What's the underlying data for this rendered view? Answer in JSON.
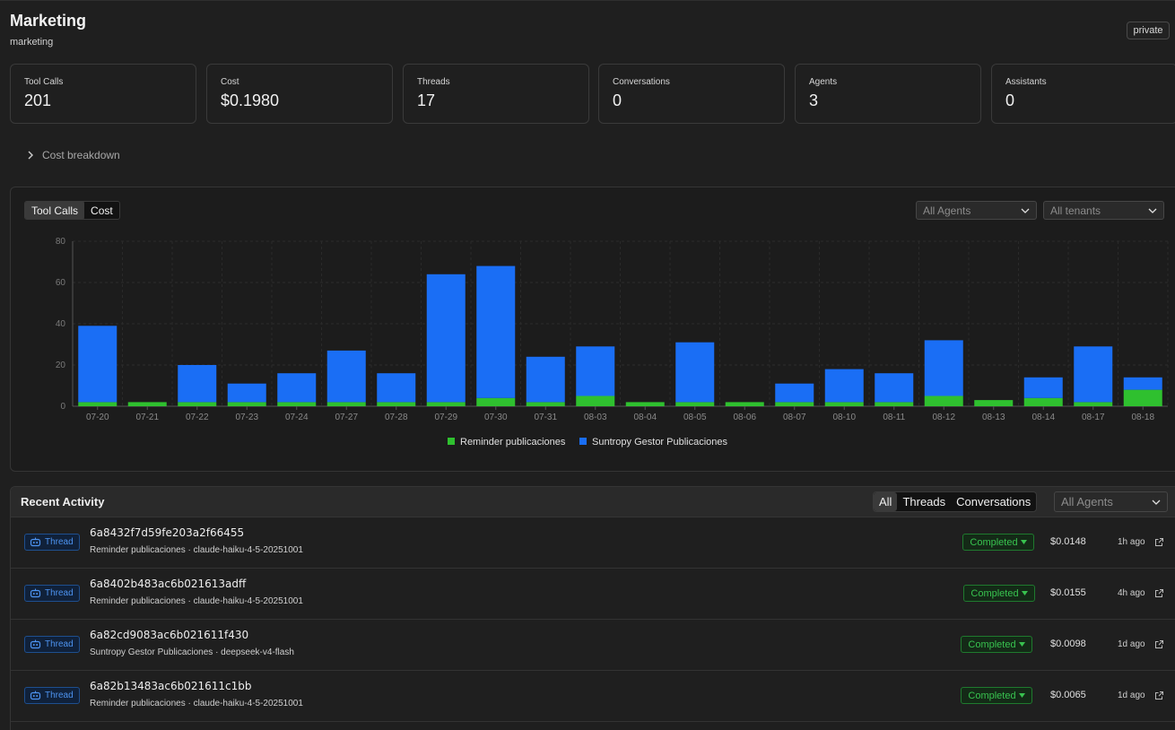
{
  "header": {
    "title": "Marketing",
    "subtitle": "marketing",
    "visibility_badge": "private"
  },
  "stats": [
    {
      "label": "Tool Calls",
      "value": "201"
    },
    {
      "label": "Cost",
      "value": "$0.1980"
    },
    {
      "label": "Threads",
      "value": "17"
    },
    {
      "label": "Conversations",
      "value": "0"
    },
    {
      "label": "Agents",
      "value": "3"
    },
    {
      "label": "Assistants",
      "value": "0"
    }
  ],
  "cost_breakdown": {
    "label": "Cost breakdown",
    "icon": "chevron-right-icon"
  },
  "chart_controls": {
    "metric_tabs": [
      "Tool Calls",
      "Cost"
    ],
    "active_tab": "Tool Calls",
    "agent_filter": "All Agents",
    "tenant_filter": "All tenants"
  },
  "chart_data": {
    "type": "bar",
    "stacked": true,
    "categories": [
      "07-20",
      "07-21",
      "07-22",
      "07-23",
      "07-24",
      "07-27",
      "07-28",
      "07-29",
      "07-30",
      "07-31",
      "08-03",
      "08-04",
      "08-05",
      "08-06",
      "08-07",
      "08-10",
      "08-11",
      "08-12",
      "08-13",
      "08-14",
      "08-17",
      "08-18"
    ],
    "series": [
      {
        "name": "Reminder publicaciones",
        "color": "#2fc02f",
        "values": [
          2,
          2,
          2,
          2,
          2,
          2,
          2,
          2,
          4,
          2,
          5,
          2,
          2,
          2,
          2,
          2,
          2,
          5,
          3,
          4,
          2,
          8
        ]
      },
      {
        "name": "Suntropy Gestor Publicaciones",
        "color": "#1a6ef5",
        "values": [
          37,
          0,
          18,
          9,
          14,
          25,
          14,
          62,
          64,
          22,
          24,
          0,
          29,
          0,
          9,
          16,
          14,
          27,
          0,
          10,
          27,
          6
        ]
      }
    ],
    "yticks": [
      "0",
      "20",
      "40",
      "60",
      "80"
    ],
    "ylim": [
      0,
      80
    ],
    "grid": true,
    "legend": "bottom-center"
  },
  "activity": {
    "title": "Recent Activity",
    "filters": [
      "All",
      "Threads",
      "Conversations"
    ],
    "active_filter": "All",
    "agent_filter": "All Agents",
    "rows": [
      {
        "type": "Thread",
        "id": "6a8432f7d59fe203a2f66455",
        "agent": "Reminder publicaciones · claude-haiku-4-5-20251001",
        "status": "Completed",
        "cost": "$0.0148",
        "time": "1h ago"
      },
      {
        "type": "Thread",
        "id": "6a8402b483ac6b021613adff",
        "agent": "Reminder publicaciones · claude-haiku-4-5-20251001",
        "status": "Completed",
        "cost": "$0.0155",
        "time": "4h ago"
      },
      {
        "type": "Thread",
        "id": "6a82cd9083ac6b021611f430",
        "agent": "Suntropy Gestor Publicaciones · deepseek-v4-flash",
        "status": "Completed",
        "cost": "$0.0098",
        "time": "1d ago"
      },
      {
        "type": "Thread",
        "id": "6a82b13483ac6b021611c1bb",
        "agent": "Reminder publicaciones · claude-haiku-4-5-20251001",
        "status": "Completed",
        "cost": "$0.0065",
        "time": "1d ago"
      }
    ]
  }
}
